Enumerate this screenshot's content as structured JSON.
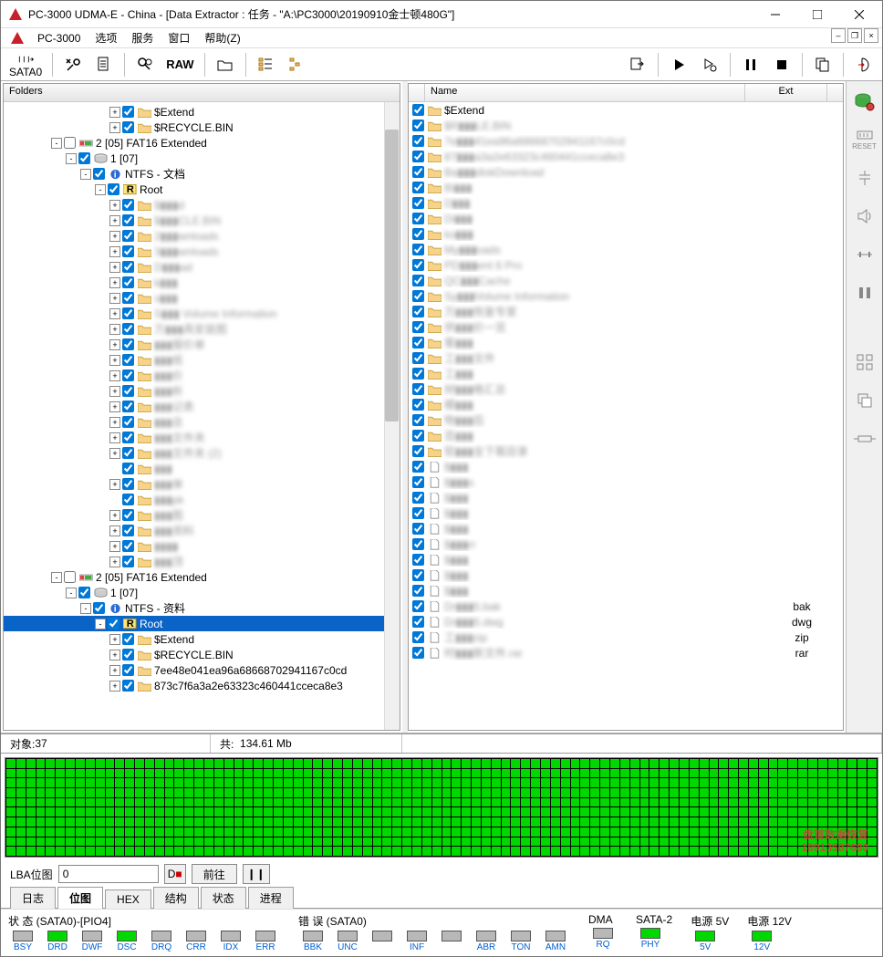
{
  "title": "PC-3000 UDMA-E - China - [Data Extractor : 任务 - \"A:\\PC3000\\20190910金士顿480G\"]",
  "menu": {
    "app": "PC-3000",
    "items": [
      "选项",
      "服务",
      "窗口",
      "帮助(Z)"
    ]
  },
  "toolbar_sata": "SATA0",
  "toolbar_raw": "RAW",
  "folders_header": "Folders",
  "tree": [
    {
      "d": 7,
      "tw": "+",
      "cb": 1,
      "icon": "folder",
      "label": "$Extend"
    },
    {
      "d": 7,
      "tw": "+",
      "cb": 1,
      "icon": "folder",
      "label": "$RECYCLE.BIN"
    },
    {
      "d": 3,
      "tw": "-",
      "cb": 0,
      "icon": "part",
      "label": "2 [05] FAT16 Extended"
    },
    {
      "d": 4,
      "tw": "-",
      "cb": 1,
      "icon": "disk",
      "label": "1 [07]"
    },
    {
      "d": 5,
      "tw": "-",
      "cb": 1,
      "icon": "info",
      "label": "NTFS - 文档"
    },
    {
      "d": 6,
      "tw": "-",
      "cb": 1,
      "icon": "root",
      "label": "Root"
    },
    {
      "d": 7,
      "tw": "+",
      "cb": 1,
      "icon": "folder",
      "label": "$▮▮▮d",
      "blur": true
    },
    {
      "d": 7,
      "tw": "+",
      "cb": 1,
      "icon": "folder",
      "label": "$▮▮▮CLE.BIN",
      "blur": true
    },
    {
      "d": 7,
      "tw": "+",
      "cb": 1,
      "icon": "folder",
      "label": "2▮▮▮wnloads",
      "blur": true
    },
    {
      "d": 7,
      "tw": "+",
      "cb": 1,
      "icon": "folder",
      "label": "3▮▮▮wnloads",
      "blur": true
    },
    {
      "d": 7,
      "tw": "+",
      "cb": 1,
      "icon": "folder",
      "label": "D▮▮▮ad",
      "blur": true
    },
    {
      "d": 7,
      "tw": "+",
      "cb": 1,
      "icon": "folder",
      "label": "k▮▮▮",
      "blur": true
    },
    {
      "d": 7,
      "tw": "+",
      "cb": 1,
      "icon": "folder",
      "label": "s▮▮▮",
      "blur": true
    },
    {
      "d": 7,
      "tw": "+",
      "cb": 1,
      "icon": "folder",
      "label": "S▮▮▮ Volume Information",
      "blur": true
    },
    {
      "d": 7,
      "tw": "+",
      "cb": 1,
      "icon": "folder",
      "label": "万▮▮▮具安装图",
      "blur": true
    },
    {
      "d": 7,
      "tw": "+",
      "cb": 1,
      "icon": "folder",
      "label": "▮▮▮报价单",
      "blur": true
    },
    {
      "d": 7,
      "tw": "+",
      "cb": 1,
      "icon": "folder",
      "label": "▮▮▮纸",
      "blur": true
    },
    {
      "d": 7,
      "tw": "+",
      "cb": 1,
      "icon": "folder",
      "label": "▮▮▮价",
      "blur": true
    },
    {
      "d": 7,
      "tw": "+",
      "cb": 1,
      "icon": "folder",
      "label": "▮▮▮析",
      "blur": true
    },
    {
      "d": 7,
      "tw": "+",
      "cb": 1,
      "icon": "folder",
      "label": "▮▮▮记表",
      "blur": true
    },
    {
      "d": 7,
      "tw": "+",
      "cb": 1,
      "icon": "folder",
      "label": "▮▮▮总",
      "blur": true
    },
    {
      "d": 7,
      "tw": "+",
      "cb": 1,
      "icon": "folder",
      "label": "▮▮▮文件夹",
      "blur": true
    },
    {
      "d": 7,
      "tw": "+",
      "cb": 1,
      "icon": "folder",
      "label": "▮▮▮文件夹 (2)",
      "blur": true
    },
    {
      "d": 7,
      "tw": "",
      "cb": 1,
      "icon": "folder",
      "label": "▮▮▮",
      "blur": true
    },
    {
      "d": 7,
      "tw": "+",
      "cb": 1,
      "icon": "folder",
      "label": "▮▮▮单",
      "blur": true
    },
    {
      "d": 7,
      "tw": "",
      "cb": 1,
      "icon": "folder",
      "label": "▮▮▮pk",
      "blur": true
    },
    {
      "d": 7,
      "tw": "+",
      "cb": 1,
      "icon": "folder",
      "label": "▮▮▮图",
      "blur": true
    },
    {
      "d": 7,
      "tw": "+",
      "cb": 1,
      "icon": "folder",
      "label": "▮▮▮资料",
      "blur": true
    },
    {
      "d": 7,
      "tw": "+",
      "cb": 1,
      "icon": "folder",
      "label": "▮▮▮▮",
      "blur": true
    },
    {
      "d": 7,
      "tw": "+",
      "cb": 1,
      "icon": "folder",
      "label": "▮▮▮顶",
      "blur": true
    },
    {
      "d": 3,
      "tw": "-",
      "cb": 0,
      "icon": "part",
      "label": "2 [05] FAT16 Extended"
    },
    {
      "d": 4,
      "tw": "-",
      "cb": 1,
      "icon": "disk",
      "label": "1 [07]"
    },
    {
      "d": 5,
      "tw": "-",
      "cb": 1,
      "icon": "info",
      "label": "NTFS - 资料"
    },
    {
      "d": 6,
      "tw": "-",
      "cb": 1,
      "icon": "root",
      "label": "Root",
      "sel": true
    },
    {
      "d": 7,
      "tw": "+",
      "cb": 1,
      "icon": "folder",
      "label": "$Extend"
    },
    {
      "d": 7,
      "tw": "+",
      "cb": 1,
      "icon": "folder",
      "label": "$RECYCLE.BIN"
    },
    {
      "d": 7,
      "tw": "+",
      "cb": 1,
      "icon": "folder",
      "label": "7ee48e041ea96a68668702941167c0cd"
    },
    {
      "d": 7,
      "tw": "+",
      "cb": 1,
      "icon": "folder",
      "label": "873c7f6a3a2e63323c460441cceca8e3"
    }
  ],
  "list_cols": {
    "name": "Name",
    "ext": "Ext"
  },
  "list": [
    {
      "icon": "folder",
      "name": "$Extend",
      "ext": ""
    },
    {
      "icon": "folder",
      "name": "$R▮▮▮LE.BIN",
      "ext": "",
      "blur": true
    },
    {
      "icon": "folder",
      "name": "7e▮▮▮41ea96a68668702941167c0cd",
      "ext": "",
      "blur": true
    },
    {
      "icon": "folder",
      "name": "87▮▮▮a3a2e63323c460441cceca8e3",
      "ext": "",
      "blur": true
    },
    {
      "icon": "folder",
      "name": "Ba▮▮▮diskDownload",
      "ext": "",
      "blur": true
    },
    {
      "icon": "folder",
      "name": "Bi▮▮▮",
      "ext": "",
      "blur": true
    },
    {
      "icon": "folder",
      "name": "D▮▮▮",
      "ext": "",
      "blur": true
    },
    {
      "icon": "folder",
      "name": "Di▮▮▮",
      "ext": "",
      "blur": true
    },
    {
      "icon": "folder",
      "name": "ks▮▮▮",
      "ext": "",
      "blur": true
    },
    {
      "icon": "folder",
      "name": "My▮▮▮oads",
      "ext": "",
      "blur": true
    },
    {
      "icon": "folder",
      "name": "PD▮▮▮ent 6 Pro",
      "ext": "",
      "blur": true
    },
    {
      "icon": "folder",
      "name": "QC▮▮▮Cache",
      "ext": "",
      "blur": true
    },
    {
      "icon": "folder",
      "name": "Sy▮▮▮Volume Information",
      "ext": "",
      "blur": true
    },
    {
      "icon": "folder",
      "name": "万▮▮▮恢复专家",
      "ext": "",
      "blur": true
    },
    {
      "icon": "folder",
      "name": "供▮▮▮价一览",
      "ext": "",
      "blur": true
    },
    {
      "icon": "folder",
      "name": "客▮▮▮",
      "ext": "",
      "blur": true
    },
    {
      "icon": "folder",
      "name": "工▮▮▮文件",
      "ext": "",
      "blur": true
    },
    {
      "icon": "folder",
      "name": "工▮▮▮",
      "ext": "",
      "blur": true
    },
    {
      "icon": "folder",
      "name": "材▮▮▮格汇总",
      "ext": "",
      "blur": true
    },
    {
      "icon": "folder",
      "name": "模▮▮▮",
      "ext": "",
      "blur": true
    },
    {
      "icon": "folder",
      "name": "物▮▮▮后",
      "ext": "",
      "blur": true
    },
    {
      "icon": "folder",
      "name": "百▮▮▮",
      "ext": "",
      "blur": true
    },
    {
      "icon": "folder",
      "name": "软▮▮▮全下载目录",
      "ext": "",
      "blur": true
    },
    {
      "icon": "file",
      "name": "$▮▮▮",
      "ext": "",
      "blur": true
    },
    {
      "icon": "file",
      "name": "$▮▮▮s",
      "ext": "",
      "blur": true
    },
    {
      "icon": "file",
      "name": "$▮▮▮",
      "ext": "",
      "blur": true
    },
    {
      "icon": "file",
      "name": "$▮▮▮",
      "ext": "",
      "blur": true
    },
    {
      "icon": "file",
      "name": "$▮▮▮",
      "ext": "",
      "blur": true
    },
    {
      "icon": "file",
      "name": "$▮▮▮rr",
      "ext": "",
      "blur": true
    },
    {
      "icon": "file",
      "name": "$▮▮▮",
      "ext": "",
      "blur": true
    },
    {
      "icon": "file",
      "name": "$▮▮▮",
      "ext": "",
      "blur": true
    },
    {
      "icon": "file",
      "name": "$▮▮▮",
      "ext": "",
      "blur": true
    },
    {
      "icon": "file",
      "name": "Dr▮▮▮5.bak",
      "ext": "bak",
      "blur": true
    },
    {
      "icon": "file",
      "name": "Dr▮▮▮5.dwg",
      "ext": "dwg",
      "blur": true
    },
    {
      "icon": "file",
      "name": "工▮▮▮zip",
      "ext": "zip",
      "blur": true
    },
    {
      "icon": "file",
      "name": "时▮▮▮新文件.rar",
      "ext": "rar",
      "blur": true
    }
  ],
  "info": {
    "objects_lbl": "对象:",
    "objects_val": "37",
    "total_lbl": "共:",
    "total_val": "134.61 Mb"
  },
  "lba": {
    "label": "LBA位图",
    "value": "0",
    "go": "前往"
  },
  "tabs": [
    "日志",
    "位图",
    "HEX",
    "结构",
    "状态",
    "进程"
  ],
  "active_tab": 1,
  "hw": {
    "status_lbl": "状 态 (SATA0)-[PIO4]",
    "status": [
      {
        "n": "BSY",
        "on": 0
      },
      {
        "n": "DRD",
        "on": 1
      },
      {
        "n": "DWF",
        "on": 0
      },
      {
        "n": "DSC",
        "on": 1
      },
      {
        "n": "DRQ",
        "on": 0
      },
      {
        "n": "CRR",
        "on": 0
      },
      {
        "n": "IDX",
        "on": 0
      },
      {
        "n": "ERR",
        "on": 0
      }
    ],
    "err_lbl": "错 误 (SATA0)",
    "err": [
      {
        "n": "BBK",
        "on": 0
      },
      {
        "n": "UNC",
        "on": 0
      },
      {
        "n": "",
        "on": 0
      },
      {
        "n": "INF",
        "on": 0
      },
      {
        "n": "",
        "on": 0
      },
      {
        "n": "ABR",
        "on": 0
      },
      {
        "n": "TON",
        "on": 0
      },
      {
        "n": "AMN",
        "on": 0
      }
    ],
    "dma_lbl": "DMA",
    "dma": [
      {
        "n": "RQ",
        "on": 0
      }
    ],
    "sata2_lbl": "SATA-2",
    "sata2": [
      {
        "n": "PHY",
        "on": 1
      }
    ],
    "pwr5_lbl": "电源 5V",
    "pwr5": [
      {
        "n": "5V",
        "on": 1
      }
    ],
    "pwr12_lbl": "电源 12V",
    "pwr12": [
      {
        "n": "12V",
        "on": 1
      }
    ]
  },
  "watermark": {
    "line1": "盘首数据恢复",
    "line2": "18913587680"
  }
}
